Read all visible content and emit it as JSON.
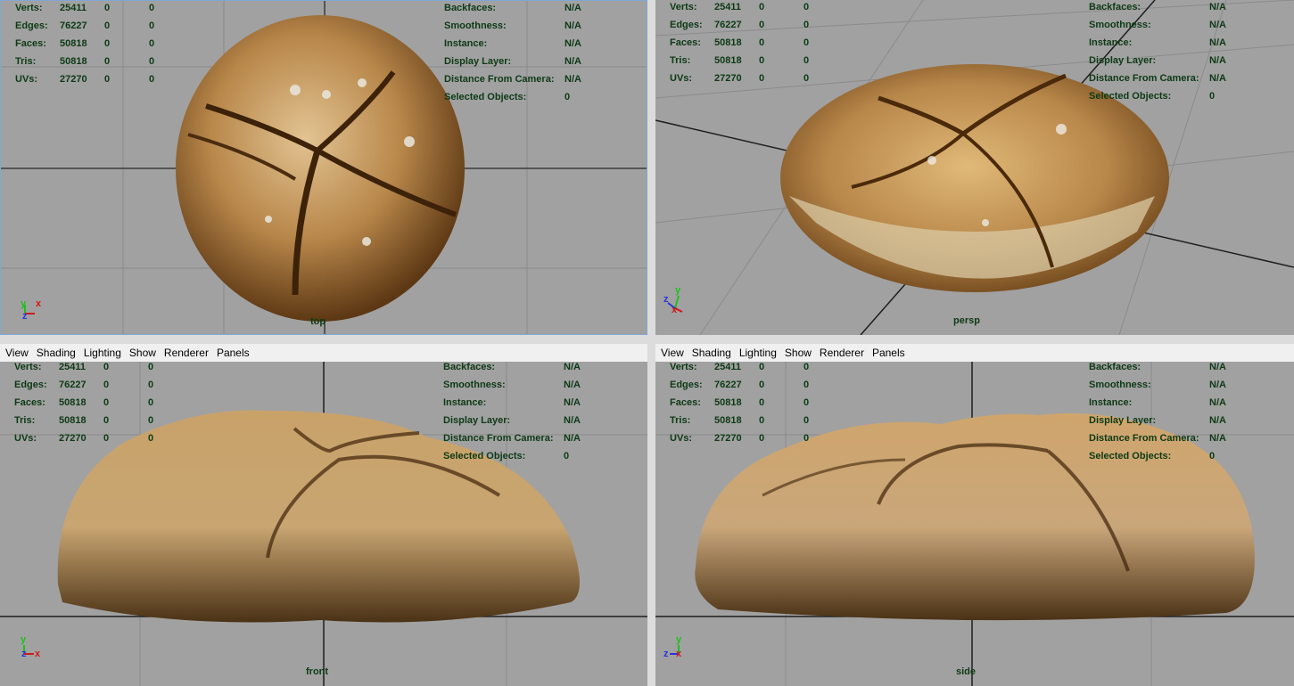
{
  "menu": [
    "View",
    "Shading",
    "Lighting",
    "Show",
    "Renderer",
    "Panels"
  ],
  "stats_left": [
    {
      "label": "Verts:",
      "a": "25411",
      "b": "0",
      "c": "0"
    },
    {
      "label": "Edges:",
      "a": "76227",
      "b": "0",
      "c": "0"
    },
    {
      "label": "Faces:",
      "a": "50818",
      "b": "0",
      "c": "0"
    },
    {
      "label": "Tris:",
      "a": "50818",
      "b": "0",
      "c": "0"
    },
    {
      "label": "UVs:",
      "a": "27270",
      "b": "0",
      "c": "0"
    }
  ],
  "stats_right": [
    {
      "label": "Backfaces:",
      "v": "N/A"
    },
    {
      "label": "Smoothness:",
      "v": "N/A"
    },
    {
      "label": "Instance:",
      "v": "N/A"
    },
    {
      "label": "Display Layer:",
      "v": "N/A"
    },
    {
      "label": "Distance From Camera:",
      "v": "N/A"
    },
    {
      "label": "Selected Objects:",
      "v": "0"
    }
  ],
  "cameras": {
    "top": "top",
    "persp": "persp",
    "front": "front",
    "side": "side"
  },
  "axes": {
    "x": "x",
    "y": "y",
    "z": "z"
  },
  "colors": {
    "viewport_bg": "#a1a1a1",
    "hud_text": "#0d3a15",
    "grid_line": "#6e6e6e",
    "axis_x": "#d11a1a",
    "axis_y": "#1fbf1f",
    "axis_z": "#2a35d8",
    "bread_light": "#d7b37a",
    "bread_dark": "#7a4b1e"
  }
}
